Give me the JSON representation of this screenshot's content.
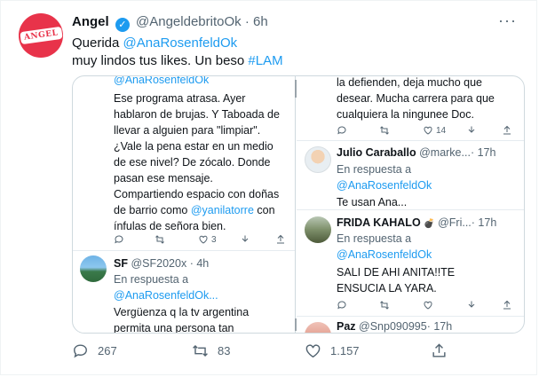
{
  "tweet": {
    "name": "Angel",
    "handle": "@AngeldebritoOk",
    "separator": "·",
    "time": "6h",
    "avatar_logo": "ANGEL",
    "text_line1_prefix": "Querida ",
    "text_mention": "@AnaRosenfeldOk",
    "text_line2_prefix": "muy lindos tus likes. Un beso ",
    "text_hashtag": "#LAM",
    "more_label": "···",
    "icons": {
      "more": "more-icon",
      "verified": "verified-badge-icon"
    }
  },
  "embedded": {
    "left": {
      "top_mention": "@AnaRosenfeldOk",
      "reply_lines": [
        "Ese programa atrasa. Ayer",
        "hablaron de brujas. Y Taboada de",
        "llevar a alguien para \"limpiar\".",
        "¿Vale la pena estar en un medio",
        "de ese nivel? De zócalo. Donde",
        "pasan ese mensaje.",
        "Compartiendo espacio con doñas",
        "de barrio como "
      ],
      "mention_inline": "@yanilatorre",
      "mention_inline_suffix": " con",
      "reply_last_line": "ínfulas de señora bien.",
      "mini_like_count": "3",
      "sf": {
        "name": "SF",
        "handle": "@SF2020x",
        "time": "· 4h",
        "in_reply": "En respuesta a",
        "mention": "@AnaRosenfeldOk...",
        "lines": [
          "Vergüenza q la tv argentina",
          "permita una persona tan"
        ]
      }
    },
    "right": {
      "top_lines": [
        "la defienden, deja mucho que",
        "desear. Mucha carrera para que",
        "cualquiera la ningunee Doc."
      ],
      "mini_like_count": "14",
      "julio": {
        "name": "Julio Caraballo",
        "handle": "@marke...",
        "time": "· 17h",
        "in_reply": "En respuesta a",
        "mention": "@AnaRosenfeldOk",
        "text": "Te usan Ana..."
      },
      "frida": {
        "name": "FRIDA KAHALO",
        "emoji": "💣",
        "handle": "@Fri...",
        "time": "· 17h",
        "in_reply": "En respuesta a",
        "mention": "@AnaRosenfeldOk",
        "lines": [
          "SALI DE AHI ANITA!!TE",
          "ENSUCIA LA YARA."
        ]
      },
      "paz": {
        "name": "Paz",
        "handle": "@Snp090995",
        "time": "· 17h"
      }
    }
  },
  "actions": {
    "reply_count": "267",
    "retweet_count": "83",
    "like_count": "1.157"
  }
}
